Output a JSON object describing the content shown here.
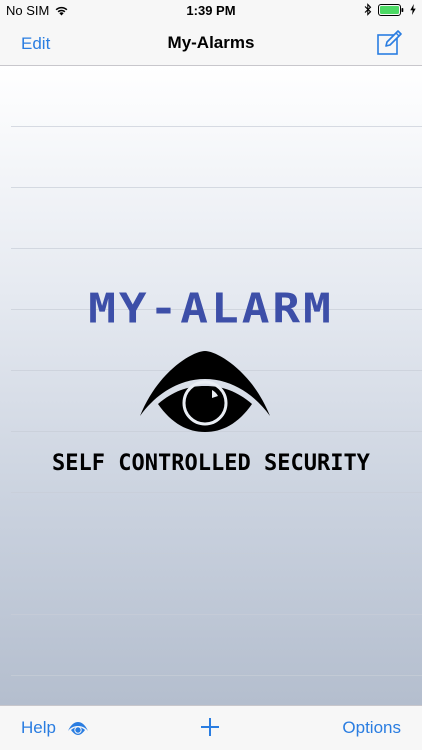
{
  "status_bar": {
    "carrier": "No SIM",
    "time": "1:39 PM"
  },
  "nav": {
    "edit_label": "Edit",
    "title": "My-Alarms"
  },
  "logo": {
    "title": "MY-ALARM",
    "tagline": "SELF CONTROLLED SECURITY"
  },
  "toolbar": {
    "help_label": "Help",
    "options_label": "Options"
  },
  "icons": {
    "wifi": "wifi-icon",
    "bluetooth": "bluetooth-icon",
    "battery": "battery-icon",
    "charging": "charging-bolt-icon",
    "compose": "compose-icon",
    "eye_logo": "eye-logo-icon",
    "eye_toolbar": "eye-icon",
    "add": "plus-icon"
  },
  "colors": {
    "accent": "#2a7de1",
    "logo_blue": "#3d4fa8",
    "battery_green": "#4cd964"
  }
}
